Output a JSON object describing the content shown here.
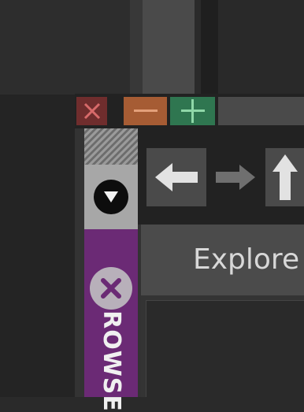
{
  "window": {
    "controls": {
      "close_icon": "close-icon",
      "minimize_icon": "minimize-icon",
      "maximize_icon": "maximize-icon",
      "colors": {
        "close": "#6f2d2d",
        "minimize": "#a65c34",
        "maximize": "#2f7650"
      }
    },
    "sidebar": {
      "dropdown_icon": "triangle-down-icon",
      "tab": {
        "label": "ROWSE",
        "close_icon": "close-circle-icon",
        "color": "#6b2a75"
      }
    },
    "toolbar": {
      "back_icon": "arrow-left-icon",
      "forward_icon": "arrow-right-icon",
      "up_icon": "arrow-up-icon"
    },
    "explorer": {
      "label": "Explore"
    }
  }
}
